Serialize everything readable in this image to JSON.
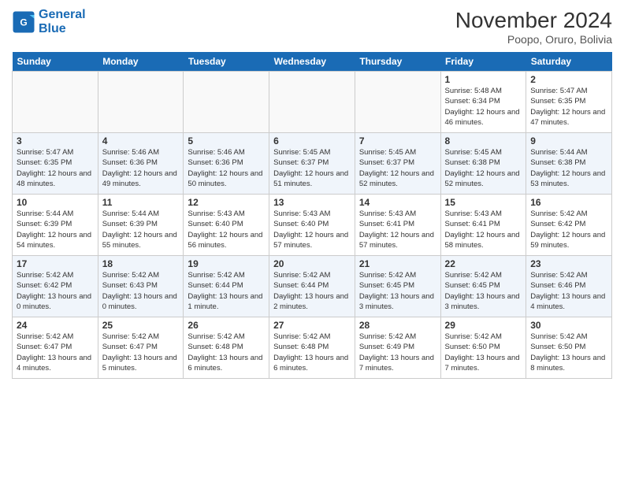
{
  "header": {
    "logo_line1": "General",
    "logo_line2": "Blue",
    "month": "November 2024",
    "location": "Poopo, Oruro, Bolivia"
  },
  "days_of_week": [
    "Sunday",
    "Monday",
    "Tuesday",
    "Wednesday",
    "Thursday",
    "Friday",
    "Saturday"
  ],
  "weeks": [
    [
      {
        "day": "",
        "empty": true
      },
      {
        "day": "",
        "empty": true
      },
      {
        "day": "",
        "empty": true
      },
      {
        "day": "",
        "empty": true
      },
      {
        "day": "",
        "empty": true
      },
      {
        "day": "1",
        "sunrise": "5:48 AM",
        "sunset": "6:34 PM",
        "daylight": "12 hours and 46 minutes."
      },
      {
        "day": "2",
        "sunrise": "5:47 AM",
        "sunset": "6:35 PM",
        "daylight": "12 hours and 47 minutes."
      }
    ],
    [
      {
        "day": "3",
        "sunrise": "5:47 AM",
        "sunset": "6:35 PM",
        "daylight": "12 hours and 48 minutes."
      },
      {
        "day": "4",
        "sunrise": "5:46 AM",
        "sunset": "6:36 PM",
        "daylight": "12 hours and 49 minutes."
      },
      {
        "day": "5",
        "sunrise": "5:46 AM",
        "sunset": "6:36 PM",
        "daylight": "12 hours and 50 minutes."
      },
      {
        "day": "6",
        "sunrise": "5:45 AM",
        "sunset": "6:37 PM",
        "daylight": "12 hours and 51 minutes."
      },
      {
        "day": "7",
        "sunrise": "5:45 AM",
        "sunset": "6:37 PM",
        "daylight": "12 hours and 52 minutes."
      },
      {
        "day": "8",
        "sunrise": "5:45 AM",
        "sunset": "6:38 PM",
        "daylight": "12 hours and 52 minutes."
      },
      {
        "day": "9",
        "sunrise": "5:44 AM",
        "sunset": "6:38 PM",
        "daylight": "12 hours and 53 minutes."
      }
    ],
    [
      {
        "day": "10",
        "sunrise": "5:44 AM",
        "sunset": "6:39 PM",
        "daylight": "12 hours and 54 minutes."
      },
      {
        "day": "11",
        "sunrise": "5:44 AM",
        "sunset": "6:39 PM",
        "daylight": "12 hours and 55 minutes."
      },
      {
        "day": "12",
        "sunrise": "5:43 AM",
        "sunset": "6:40 PM",
        "daylight": "12 hours and 56 minutes."
      },
      {
        "day": "13",
        "sunrise": "5:43 AM",
        "sunset": "6:40 PM",
        "daylight": "12 hours and 57 minutes."
      },
      {
        "day": "14",
        "sunrise": "5:43 AM",
        "sunset": "6:41 PM",
        "daylight": "12 hours and 57 minutes."
      },
      {
        "day": "15",
        "sunrise": "5:43 AM",
        "sunset": "6:41 PM",
        "daylight": "12 hours and 58 minutes."
      },
      {
        "day": "16",
        "sunrise": "5:42 AM",
        "sunset": "6:42 PM",
        "daylight": "12 hours and 59 minutes."
      }
    ],
    [
      {
        "day": "17",
        "sunrise": "5:42 AM",
        "sunset": "6:42 PM",
        "daylight": "13 hours and 0 minutes."
      },
      {
        "day": "18",
        "sunrise": "5:42 AM",
        "sunset": "6:43 PM",
        "daylight": "13 hours and 0 minutes."
      },
      {
        "day": "19",
        "sunrise": "5:42 AM",
        "sunset": "6:44 PM",
        "daylight": "13 hours and 1 minute."
      },
      {
        "day": "20",
        "sunrise": "5:42 AM",
        "sunset": "6:44 PM",
        "daylight": "13 hours and 2 minutes."
      },
      {
        "day": "21",
        "sunrise": "5:42 AM",
        "sunset": "6:45 PM",
        "daylight": "13 hours and 3 minutes."
      },
      {
        "day": "22",
        "sunrise": "5:42 AM",
        "sunset": "6:45 PM",
        "daylight": "13 hours and 3 minutes."
      },
      {
        "day": "23",
        "sunrise": "5:42 AM",
        "sunset": "6:46 PM",
        "daylight": "13 hours and 4 minutes."
      }
    ],
    [
      {
        "day": "24",
        "sunrise": "5:42 AM",
        "sunset": "6:47 PM",
        "daylight": "13 hours and 4 minutes."
      },
      {
        "day": "25",
        "sunrise": "5:42 AM",
        "sunset": "6:47 PM",
        "daylight": "13 hours and 5 minutes."
      },
      {
        "day": "26",
        "sunrise": "5:42 AM",
        "sunset": "6:48 PM",
        "daylight": "13 hours and 6 minutes."
      },
      {
        "day": "27",
        "sunrise": "5:42 AM",
        "sunset": "6:48 PM",
        "daylight": "13 hours and 6 minutes."
      },
      {
        "day": "28",
        "sunrise": "5:42 AM",
        "sunset": "6:49 PM",
        "daylight": "13 hours and 7 minutes."
      },
      {
        "day": "29",
        "sunrise": "5:42 AM",
        "sunset": "6:50 PM",
        "daylight": "13 hours and 7 minutes."
      },
      {
        "day": "30",
        "sunrise": "5:42 AM",
        "sunset": "6:50 PM",
        "daylight": "13 hours and 8 minutes."
      }
    ]
  ]
}
